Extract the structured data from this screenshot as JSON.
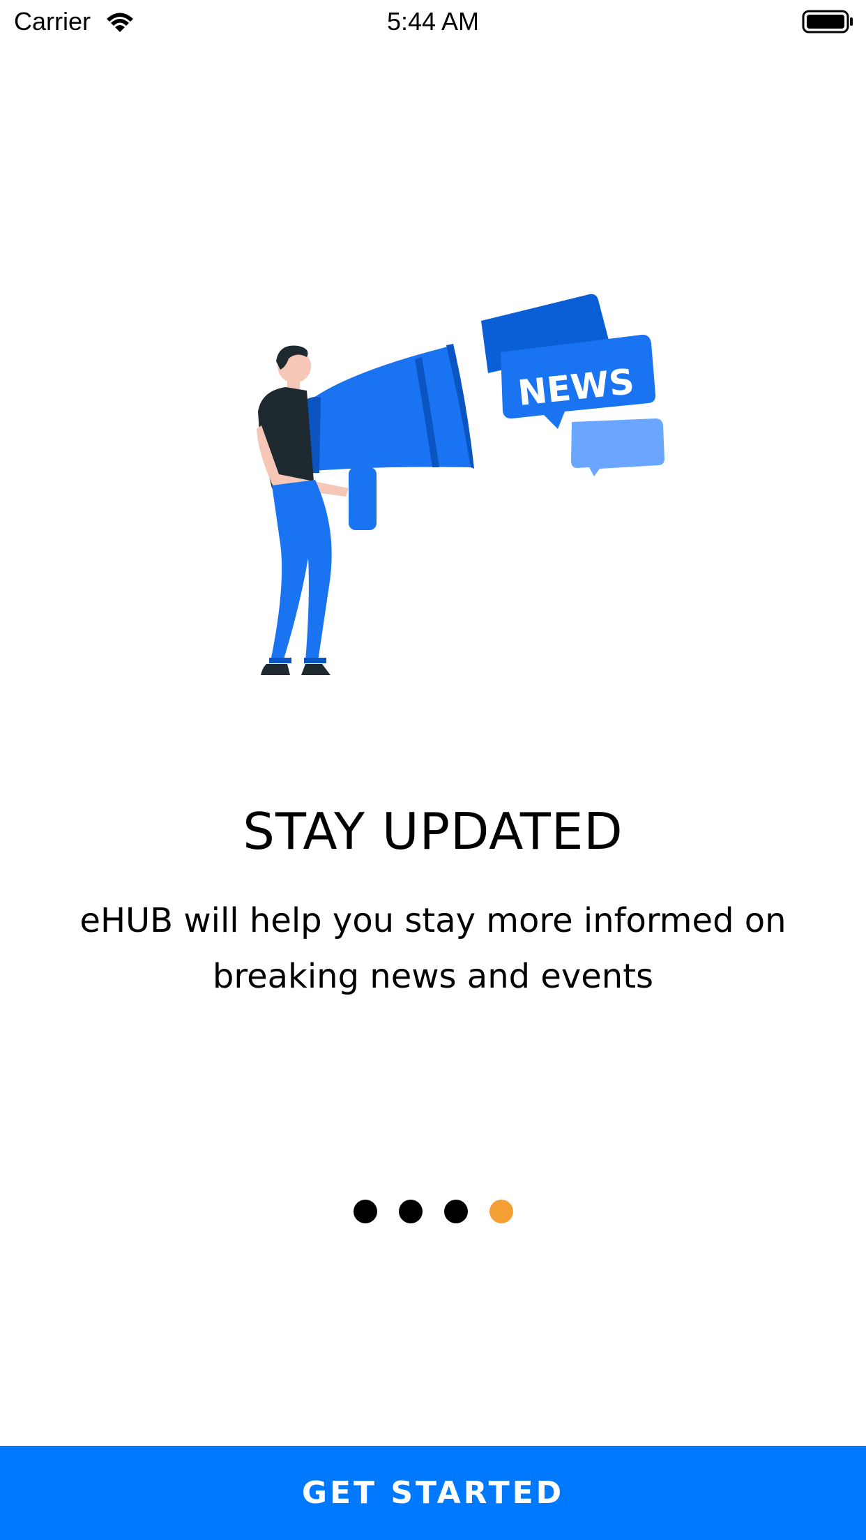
{
  "status_bar": {
    "carrier": "Carrier",
    "time": "5:44 AM"
  },
  "illustration": {
    "bubble_label": "NEWS",
    "icons": [
      "person-with-megaphone-illustration",
      "news-speech-bubble-icon"
    ]
  },
  "onboarding": {
    "title": "STAY UPDATED",
    "description": "eHUB will help you stay more informed on breaking news and events"
  },
  "pager": {
    "total_pages": 4,
    "active_page": 4,
    "dot_color": "#000000",
    "active_color": "#f5a035"
  },
  "cta": {
    "label": "GET STARTED",
    "color": "#0079ff"
  }
}
